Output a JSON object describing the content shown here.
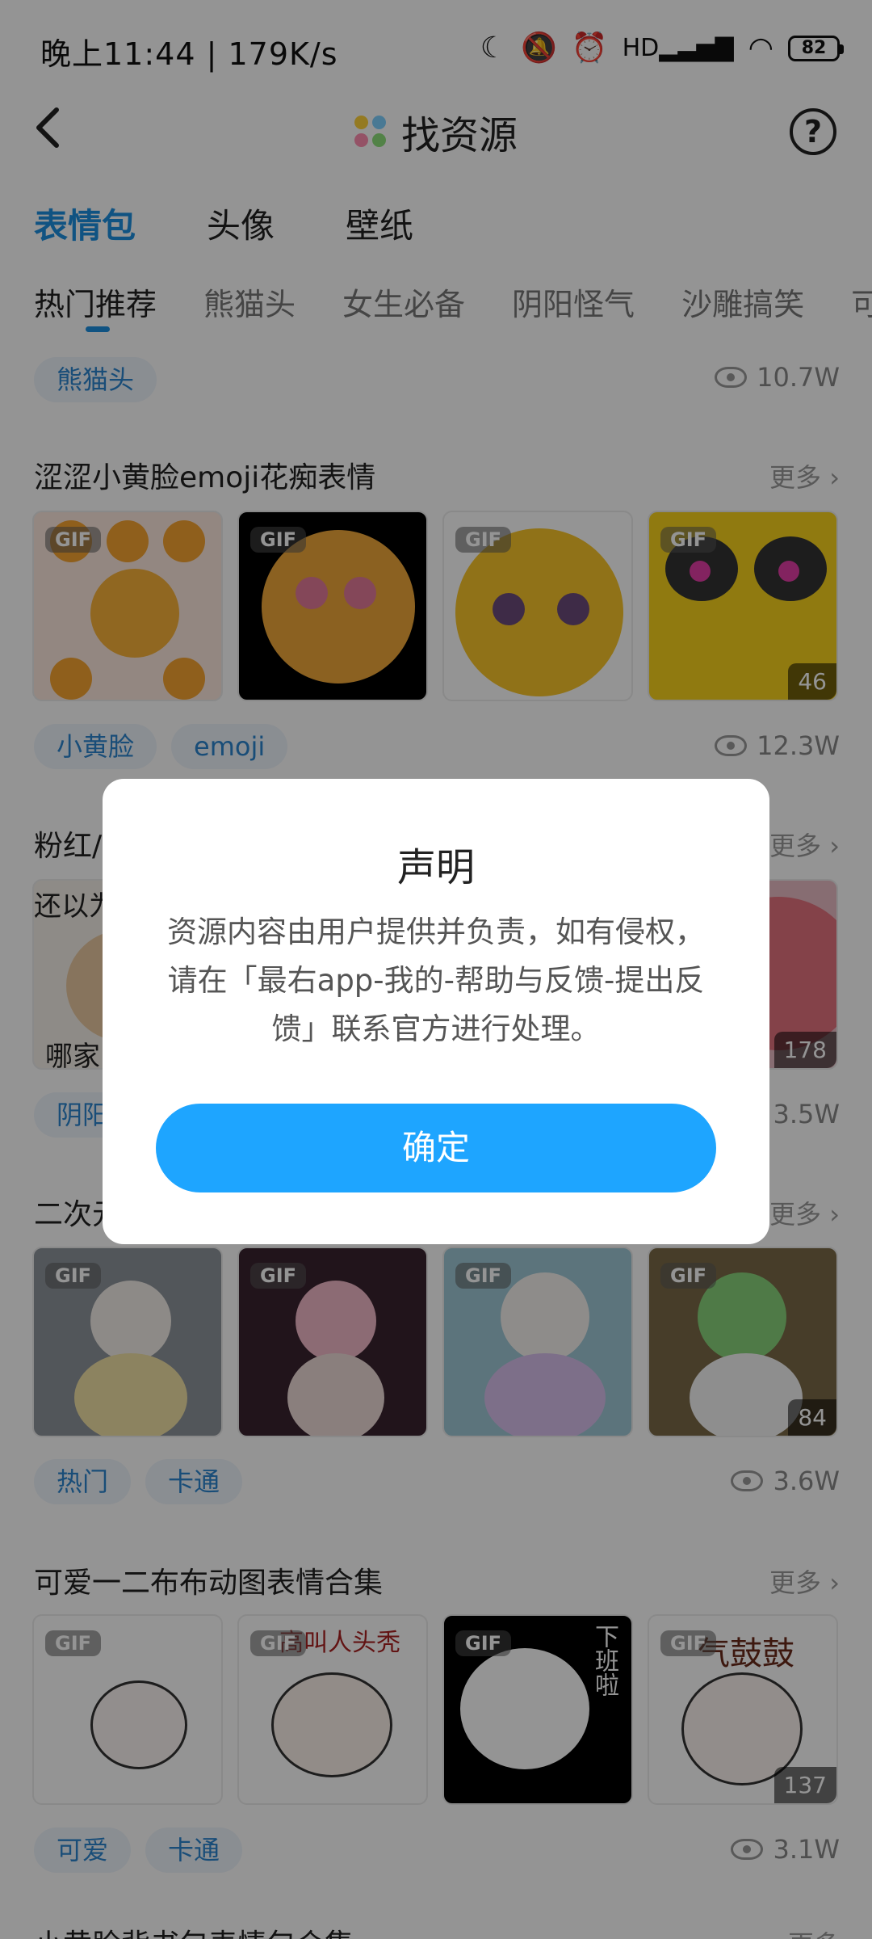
{
  "status_bar": {
    "time": "晚上11:44 | 179K/s",
    "battery": "82",
    "icons": [
      "moon-icon",
      "bell-off-icon",
      "alarm-icon",
      "hd-signal-icon",
      "wifi-icon",
      "battery-icon"
    ]
  },
  "header": {
    "title": "找资源",
    "back_icon": "chevron-left-icon",
    "help_icon": "help-icon"
  },
  "primary_tabs": [
    {
      "label": "表情包",
      "active": true
    },
    {
      "label": "头像",
      "active": false
    },
    {
      "label": "壁纸",
      "active": false
    }
  ],
  "category_tabs": [
    {
      "label": "热门推荐",
      "active": true
    },
    {
      "label": "熊猫头"
    },
    {
      "label": "女生必备"
    },
    {
      "label": "阴阳怪气"
    },
    {
      "label": "沙雕搞笑"
    },
    {
      "label": "可"
    }
  ],
  "top_row": {
    "tags": [
      "熊猫头"
    ],
    "views": "10.7W"
  },
  "sections": [
    {
      "title": "涩涩小黄脸emoji花痴表情",
      "more": "更多",
      "thumbs": [
        {
          "gif": "GIF"
        },
        {
          "gif": "GIF"
        },
        {
          "gif": "GIF"
        },
        {
          "gif": "GIF",
          "count": "46"
        }
      ],
      "tags": [
        "小黄脸",
        "emoji"
      ],
      "views": "12.3W"
    },
    {
      "title": "粉红/",
      "more": "更多",
      "thumbs": [
        {
          "text_top": "还以为",
          "text_bottom": "哪家"
        },
        {},
        {},
        {
          "count": "178"
        }
      ],
      "tags": [
        "阴阳"
      ],
      "views": "3.5W"
    },
    {
      "title": "二次元",
      "more": "更多",
      "thumbs": [
        {
          "gif": "GIF"
        },
        {
          "gif": "GIF"
        },
        {
          "gif": "GIF"
        },
        {
          "gif": "GIF",
          "count": "84"
        }
      ],
      "tags": [
        "热门",
        "卡通"
      ],
      "views": "3.6W"
    },
    {
      "title": "可爱一二布布动图表情合集",
      "more": "更多",
      "thumbs": [
        {
          "gif": "GIF"
        },
        {
          "gif": "GIF",
          "caption": "高叫人头秃"
        },
        {
          "gif": "GIF",
          "caption": "下班啦"
        },
        {
          "gif": "GIF",
          "caption": "气鼓鼓",
          "count": "137"
        }
      ],
      "tags": [
        "可爱",
        "卡通"
      ],
      "views": "3.1W"
    },
    {
      "title": "小黄脸背书包表情包合集",
      "more": "更多"
    }
  ],
  "dialog": {
    "title": "声明",
    "body": "资源内容由用户提供并负责，如有侵权，请在「最右app-我的-帮助与反馈-提出反馈」联系官方进行处理。",
    "confirm": "确定"
  },
  "colors": {
    "accent": "#1d8fe0",
    "button": "#1ea5ff",
    "tag_bg": "#eef5fc",
    "overlay": "rgba(0,0,0,0.42)"
  }
}
